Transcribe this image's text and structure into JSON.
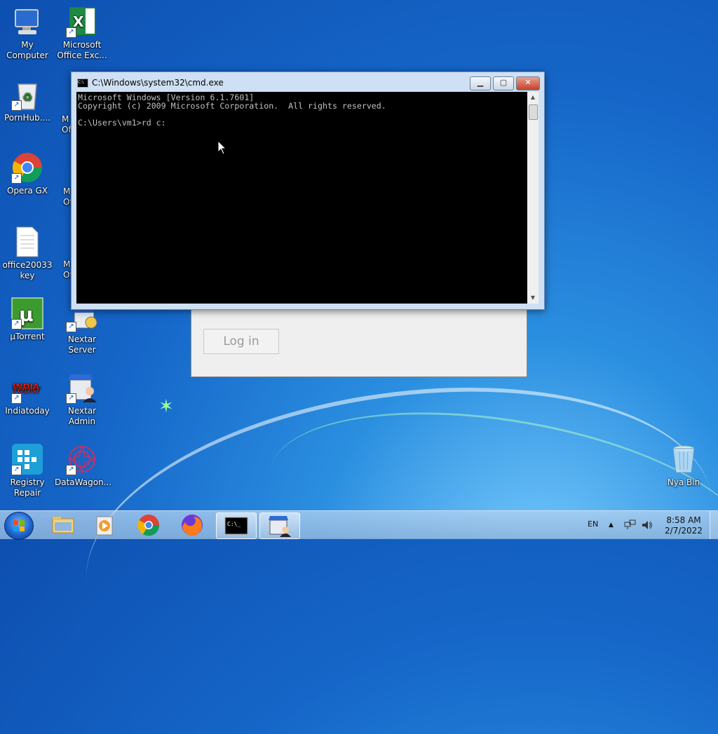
{
  "desktop": {
    "icons": [
      {
        "label": "My Computer",
        "icon": "computer-icon"
      },
      {
        "label": "Microsoft Office Exc...",
        "icon": "excel-icon"
      },
      {
        "label": "PornHub....",
        "icon": "recycle-bin-full-icon"
      },
      {
        "label": "Opera GX",
        "icon": "chrome-icon"
      },
      {
        "label": "office20033 key",
        "icon": "text-file-icon"
      },
      {
        "label": "µTorrent",
        "icon": "utorrent-icon"
      },
      {
        "label": "Nextar Server",
        "icon": "nextar-server-icon"
      },
      {
        "label": "Indiatoday",
        "icon": "india-today-icon"
      },
      {
        "label": "Nextar Admin",
        "icon": "nextar-admin-icon"
      },
      {
        "label": "Registry Repair",
        "icon": "registry-repair-icon"
      },
      {
        "label": "DataWagon...",
        "icon": "datawagon-icon"
      },
      {
        "label": "Nya Bin",
        "icon": "recycle-bin-empty-icon"
      }
    ],
    "partial_labels": [
      "M",
      "Of",
      "M",
      "Of",
      "M",
      "Offi"
    ]
  },
  "login_window": {
    "button_label": "Log in"
  },
  "cmd_window": {
    "title": "C:\\Windows\\system32\\cmd.exe",
    "icon_text": "C:\\",
    "lines": [
      "Microsoft Windows [Version 6.1.7601]",
      "Copyright (c) 2009 Microsoft Corporation.  All rights reserved.",
      "",
      "C:\\Users\\vm1>rd c:"
    ]
  },
  "taskbar": {
    "apps": [
      {
        "name": "start-button"
      },
      {
        "name": "file-explorer-icon"
      },
      {
        "name": "media-player-icon"
      },
      {
        "name": "chrome-icon"
      },
      {
        "name": "firefox-icon"
      },
      {
        "name": "cmd-icon",
        "active": true
      },
      {
        "name": "nextar-icon",
        "active": true
      }
    ],
    "language": "EN",
    "time": "8:58 AM",
    "date": "2/7/2022"
  }
}
